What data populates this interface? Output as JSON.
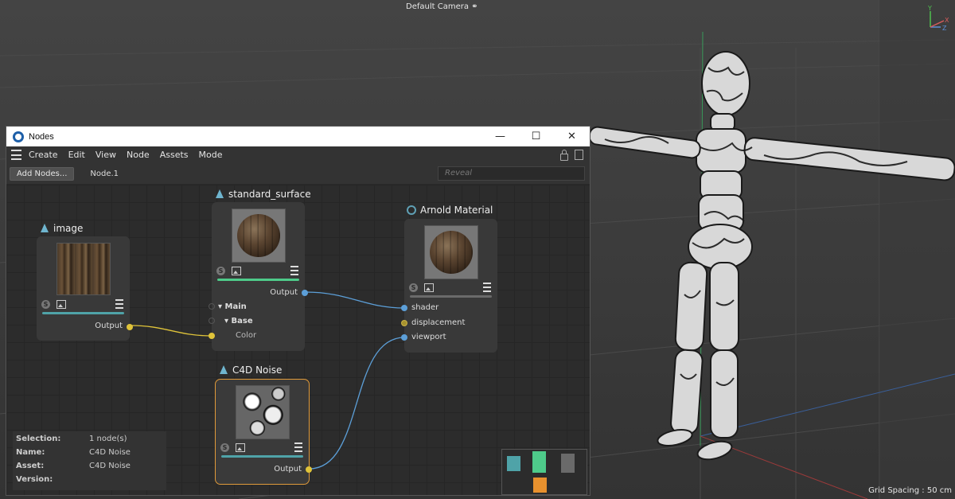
{
  "viewport": {
    "camera_label": "Default Camera",
    "camera_icon": "camera-icon",
    "grid_spacing": "Grid Spacing : 50 cm",
    "axis_labels": {
      "y": "Y",
      "z": "Z",
      "x": "X"
    }
  },
  "window": {
    "title": "Nodes",
    "app_icon": "cinema4d-icon",
    "minimize": "—",
    "maximize": "☐",
    "close": "✕"
  },
  "menu": {
    "items": [
      "Create",
      "Edit",
      "View",
      "Node",
      "Assets",
      "Mode"
    ]
  },
  "toolbar": {
    "add_nodes_label": "Add Nodes...",
    "node_name": "Node.1",
    "reveal_placeholder": "Reveal"
  },
  "nodes": {
    "image": {
      "title": "image",
      "output": "Output",
      "bar_color": "#4fa3a8"
    },
    "standard_surface": {
      "title": "standard_surface",
      "output": "Output",
      "bar_color": "#4ecb8a",
      "groups": {
        "main": "Main",
        "base": "Base",
        "color": "Color"
      }
    },
    "arnold_material": {
      "title": "Arnold Material",
      "bar_color": "#6a6a6a",
      "inputs": [
        "shader",
        "displacement",
        "viewport"
      ]
    },
    "c4d_noise": {
      "title": "C4D Noise",
      "output": "Output",
      "bar_color": "#4fa3a8",
      "selected_outline": "#e09a3a"
    }
  },
  "info": {
    "rows": [
      {
        "key": "Selection:",
        "value": "1 node(s)"
      },
      {
        "key": "Name:",
        "value": "C4D Noise"
      },
      {
        "key": "Asset:",
        "value": "C4D Noise"
      },
      {
        "key": "Version:",
        "value": ""
      }
    ]
  },
  "minimap": {
    "colors": {
      "teal": "#4fa3a8",
      "green": "#4ecb8a",
      "gray": "#6a6a6a",
      "orange": "#e8912e"
    }
  },
  "wire_colors": {
    "yellow": "#e0c43a",
    "blue": "#5c9fd8"
  }
}
